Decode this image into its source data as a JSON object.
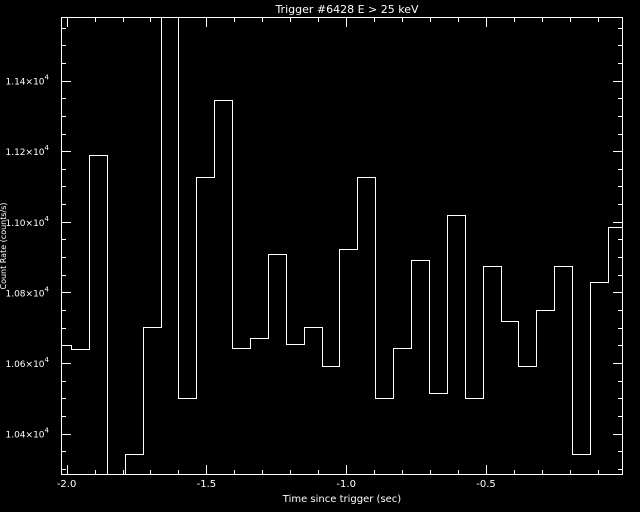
{
  "chart_data": {
    "type": "line",
    "title": "Trigger #6428  E > 25 keV",
    "xlabel": "Time since trigger (sec)",
    "ylabel": "Count Rate (counts/s)",
    "xlim": [
      -2.02,
      -0.01
    ],
    "ylim": [
      10283,
      11580
    ],
    "grid": false,
    "legend": "none",
    "xticks": [
      {
        "value": -2.0,
        "label": "-2.0"
      },
      {
        "value": -1.5,
        "label": "-1.5"
      },
      {
        "value": -1.0,
        "label": "-1.0"
      },
      {
        "value": -0.5,
        "label": "-0.5"
      }
    ],
    "yticks": [
      {
        "value": 10400,
        "label": "1.04×10",
        "exp": "4"
      },
      {
        "value": 10600,
        "label": "1.06×10",
        "exp": "4"
      },
      {
        "value": 10800,
        "label": "1.08×10",
        "exp": "4"
      },
      {
        "value": 11000,
        "label": "1.10×10",
        "exp": "4"
      },
      {
        "value": 11200,
        "label": "1.12×10",
        "exp": "4"
      },
      {
        "value": 11400,
        "label": "1.14×10",
        "exp": "4"
      }
    ],
    "bins": {
      "x": [
        -2.02,
        -1.984,
        -1.92,
        -1.856,
        -1.792,
        -1.728,
        -1.664,
        -1.6,
        -1.536,
        -1.472,
        -1.408,
        -1.344,
        -1.28,
        -1.216,
        -1.152,
        -1.088,
        -1.024,
        -0.96,
        -0.896,
        -0.832,
        -0.768,
        -0.704,
        -0.64,
        -0.576,
        -0.512,
        -0.448,
        -0.384,
        -0.32,
        -0.256,
        -0.192,
        -0.128,
        -0.064,
        -0.01
      ],
      "y": [
        10652,
        10641,
        11188,
        10230,
        10343,
        10703,
        11620,
        10500,
        11127,
        11345,
        10642,
        10671,
        10909,
        10655,
        10702,
        10592,
        10922,
        11127,
        10500,
        10642,
        10892,
        10515,
        11018,
        10500,
        10876,
        10719,
        10592,
        10750,
        10876,
        10343,
        10829,
        10985
      ]
    }
  }
}
